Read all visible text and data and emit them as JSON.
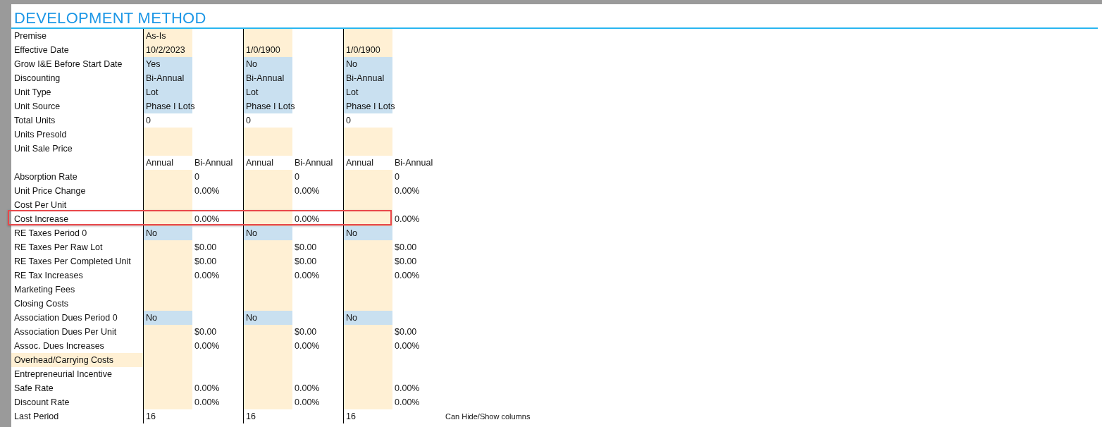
{
  "title": "DEVELOPMENT METHOD",
  "rows": [
    {
      "label": "Premise",
      "highlighted": false,
      "outlined": false,
      "cells": [
        {
          "kind": "input",
          "text": "As-Is"
        },
        {
          "kind": "plain"
        },
        {
          "kind": "input"
        },
        {
          "kind": "plain"
        },
        {
          "kind": "input"
        },
        {
          "kind": "plain"
        }
      ]
    },
    {
      "label": "Effective Date",
      "highlighted": false,
      "outlined": false,
      "cells": [
        {
          "kind": "input",
          "text": "10/2/2023"
        },
        {
          "kind": "plain"
        },
        {
          "kind": "input",
          "text": "1/0/1900"
        },
        {
          "kind": "plain"
        },
        {
          "kind": "input",
          "text": "1/0/1900"
        },
        {
          "kind": "plain"
        }
      ]
    },
    {
      "label": "Grow I&E Before Start Date",
      "highlighted": false,
      "outlined": false,
      "cells": [
        {
          "kind": "choice",
          "text": "Yes"
        },
        {
          "kind": "plain"
        },
        {
          "kind": "choice",
          "text": "No"
        },
        {
          "kind": "plain"
        },
        {
          "kind": "choice",
          "text": "No"
        },
        {
          "kind": "plain"
        }
      ]
    },
    {
      "label": "Discounting",
      "highlighted": false,
      "outlined": false,
      "cells": [
        {
          "kind": "choice",
          "text": "Bi-Annual"
        },
        {
          "kind": "plain"
        },
        {
          "kind": "choice",
          "text": "Bi-Annual"
        },
        {
          "kind": "plain"
        },
        {
          "kind": "choice",
          "text": "Bi-Annual"
        },
        {
          "kind": "plain"
        }
      ]
    },
    {
      "label": "Unit Type",
      "highlighted": false,
      "outlined": false,
      "cells": [
        {
          "kind": "choice",
          "text": "Lot"
        },
        {
          "kind": "plain"
        },
        {
          "kind": "choice",
          "text": "Lot"
        },
        {
          "kind": "plain"
        },
        {
          "kind": "choice",
          "text": "Lot"
        },
        {
          "kind": "plain"
        }
      ]
    },
    {
      "label": "Unit Source",
      "highlighted": false,
      "outlined": false,
      "cells": [
        {
          "kind": "choice",
          "text": "Phase I Lots"
        },
        {
          "kind": "plain"
        },
        {
          "kind": "choice",
          "text": "Phase I Lots"
        },
        {
          "kind": "plain"
        },
        {
          "kind": "choice",
          "text": "Phase I Lots"
        },
        {
          "kind": "plain"
        }
      ]
    },
    {
      "label": "Total Units",
      "highlighted": false,
      "outlined": false,
      "cells": [
        {
          "kind": "plain",
          "text": "0"
        },
        {
          "kind": "plain"
        },
        {
          "kind": "plain",
          "text": "0"
        },
        {
          "kind": "plain"
        },
        {
          "kind": "plain",
          "text": "0"
        },
        {
          "kind": "plain"
        }
      ]
    },
    {
      "label": "Units Presold",
      "highlighted": false,
      "outlined": false,
      "cells": [
        {
          "kind": "input"
        },
        {
          "kind": "plain"
        },
        {
          "kind": "input"
        },
        {
          "kind": "plain"
        },
        {
          "kind": "input"
        },
        {
          "kind": "plain"
        }
      ]
    },
    {
      "label": "Unit Sale Price",
      "highlighted": false,
      "outlined": false,
      "cells": [
        {
          "kind": "input"
        },
        {
          "kind": "plain"
        },
        {
          "kind": "input"
        },
        {
          "kind": "plain"
        },
        {
          "kind": "input"
        },
        {
          "kind": "plain"
        }
      ]
    },
    {
      "highlighted": false,
      "outlined": false,
      "cells": [
        {
          "kind": "plain",
          "text": "Annual"
        },
        {
          "kind": "plain",
          "text": "Bi-Annual"
        },
        {
          "kind": "plain",
          "text": "Annual"
        },
        {
          "kind": "plain",
          "text": "Bi-Annual"
        },
        {
          "kind": "plain",
          "text": "Annual"
        },
        {
          "kind": "plain",
          "text": "Bi-Annual"
        }
      ]
    },
    {
      "label": "Absorption Rate",
      "highlighted": false,
      "outlined": false,
      "cells": [
        {
          "kind": "input"
        },
        {
          "kind": "plain",
          "text": "0"
        },
        {
          "kind": "input"
        },
        {
          "kind": "plain",
          "text": "0"
        },
        {
          "kind": "input"
        },
        {
          "kind": "plain",
          "text": "0"
        }
      ]
    },
    {
      "label": "Unit Price Change",
      "highlighted": false,
      "outlined": false,
      "cells": [
        {
          "kind": "input"
        },
        {
          "kind": "plain",
          "text": "0.00%"
        },
        {
          "kind": "input"
        },
        {
          "kind": "plain",
          "text": "0.00%"
        },
        {
          "kind": "input"
        },
        {
          "kind": "plain",
          "text": "0.00%"
        }
      ]
    },
    {
      "label": "Cost Per Unit",
      "highlighted": false,
      "outlined": false,
      "cells": [
        {
          "kind": "input"
        },
        {
          "kind": "plain"
        },
        {
          "kind": "input"
        },
        {
          "kind": "plain"
        },
        {
          "kind": "input"
        },
        {
          "kind": "plain"
        }
      ]
    },
    {
      "label": "Cost Increase",
      "highlighted": false,
      "outlined": true,
      "cells": [
        {
          "kind": "input"
        },
        {
          "kind": "plain",
          "text": "0.00%"
        },
        {
          "kind": "input"
        },
        {
          "kind": "plain",
          "text": "0.00%"
        },
        {
          "kind": "input"
        },
        {
          "kind": "plain",
          "text": "0.00%"
        }
      ]
    },
    {
      "label": "RE Taxes Period 0",
      "highlighted": false,
      "outlined": false,
      "cells": [
        {
          "kind": "choice",
          "text": "No"
        },
        {
          "kind": "plain"
        },
        {
          "kind": "choice",
          "text": "No"
        },
        {
          "kind": "plain"
        },
        {
          "kind": "choice",
          "text": "No"
        },
        {
          "kind": "plain"
        }
      ]
    },
    {
      "label": "RE Taxes Per Raw Lot",
      "highlighted": false,
      "outlined": false,
      "cells": [
        {
          "kind": "input"
        },
        {
          "kind": "plain",
          "text": "$0.00"
        },
        {
          "kind": "input"
        },
        {
          "kind": "plain",
          "text": "$0.00"
        },
        {
          "kind": "input"
        },
        {
          "kind": "plain",
          "text": "$0.00"
        }
      ]
    },
    {
      "label": "RE Taxes Per Completed Unit",
      "highlighted": false,
      "outlined": false,
      "cells": [
        {
          "kind": "input"
        },
        {
          "kind": "plain",
          "text": "$0.00"
        },
        {
          "kind": "input"
        },
        {
          "kind": "plain",
          "text": "$0.00"
        },
        {
          "kind": "input"
        },
        {
          "kind": "plain",
          "text": "$0.00"
        }
      ]
    },
    {
      "label": "RE Tax Increases",
      "highlighted": false,
      "outlined": false,
      "cells": [
        {
          "kind": "input"
        },
        {
          "kind": "plain",
          "text": "0.00%"
        },
        {
          "kind": "input"
        },
        {
          "kind": "plain",
          "text": "0.00%"
        },
        {
          "kind": "input"
        },
        {
          "kind": "plain",
          "text": "0.00%"
        }
      ]
    },
    {
      "label": "Marketing Fees",
      "highlighted": false,
      "outlined": false,
      "cells": [
        {
          "kind": "input"
        },
        {
          "kind": "plain"
        },
        {
          "kind": "input"
        },
        {
          "kind": "plain"
        },
        {
          "kind": "input"
        },
        {
          "kind": "plain"
        }
      ]
    },
    {
      "label": "Closing Costs",
      "highlighted": false,
      "outlined": false,
      "cells": [
        {
          "kind": "input"
        },
        {
          "kind": "plain"
        },
        {
          "kind": "input"
        },
        {
          "kind": "plain"
        },
        {
          "kind": "input"
        },
        {
          "kind": "plain"
        }
      ]
    },
    {
      "label": "Association Dues Period 0",
      "highlighted": false,
      "outlined": false,
      "cells": [
        {
          "kind": "choice",
          "text": "No"
        },
        {
          "kind": "plain"
        },
        {
          "kind": "choice",
          "text": "No"
        },
        {
          "kind": "plain"
        },
        {
          "kind": "choice",
          "text": "No"
        },
        {
          "kind": "plain"
        }
      ]
    },
    {
      "label": "Association Dues Per Unit",
      "highlighted": false,
      "outlined": false,
      "cells": [
        {
          "kind": "input"
        },
        {
          "kind": "plain",
          "text": "$0.00"
        },
        {
          "kind": "input"
        },
        {
          "kind": "plain",
          "text": "$0.00"
        },
        {
          "kind": "input"
        },
        {
          "kind": "plain",
          "text": "$0.00"
        }
      ]
    },
    {
      "label": "Assoc. Dues Increases",
      "highlighted": false,
      "outlined": false,
      "cells": [
        {
          "kind": "input"
        },
        {
          "kind": "plain",
          "text": "0.00%"
        },
        {
          "kind": "input"
        },
        {
          "kind": "plain",
          "text": "0.00%"
        },
        {
          "kind": "input"
        },
        {
          "kind": "plain",
          "text": "0.00%"
        }
      ]
    },
    {
      "label": "Overhead/Carrying Costs",
      "highlighted": true,
      "outlined": false,
      "cells": [
        {
          "kind": "input"
        },
        {
          "kind": "plain"
        },
        {
          "kind": "input"
        },
        {
          "kind": "plain"
        },
        {
          "kind": "input"
        },
        {
          "kind": "plain"
        }
      ]
    },
    {
      "label": "Entrepreneurial Incentive",
      "highlighted": false,
      "outlined": false,
      "cells": [
        {
          "kind": "input"
        },
        {
          "kind": "plain"
        },
        {
          "kind": "input"
        },
        {
          "kind": "plain"
        },
        {
          "kind": "input"
        },
        {
          "kind": "plain"
        }
      ]
    },
    {
      "label": "Safe Rate",
      "highlighted": false,
      "outlined": false,
      "cells": [
        {
          "kind": "input"
        },
        {
          "kind": "plain",
          "text": "0.00%"
        },
        {
          "kind": "input"
        },
        {
          "kind": "plain",
          "text": "0.00%"
        },
        {
          "kind": "input"
        },
        {
          "kind": "plain",
          "text": "0.00%"
        }
      ]
    },
    {
      "label": "Discount Rate",
      "highlighted": false,
      "outlined": false,
      "cells": [
        {
          "kind": "input"
        },
        {
          "kind": "plain",
          "text": "0.00%"
        },
        {
          "kind": "input"
        },
        {
          "kind": "plain",
          "text": "0.00%"
        },
        {
          "kind": "input"
        },
        {
          "kind": "plain",
          "text": "0.00%"
        }
      ]
    },
    {
      "label": "Last Period",
      "highlighted": false,
      "outlined": false,
      "note": "Can Hide/Show columns",
      "cells": [
        {
          "kind": "plain",
          "text": "16"
        },
        {
          "kind": "plain"
        },
        {
          "kind": "plain",
          "text": "16"
        },
        {
          "kind": "plain"
        },
        {
          "kind": "plain",
          "text": "16"
        },
        {
          "kind": "plain"
        }
      ]
    }
  ]
}
